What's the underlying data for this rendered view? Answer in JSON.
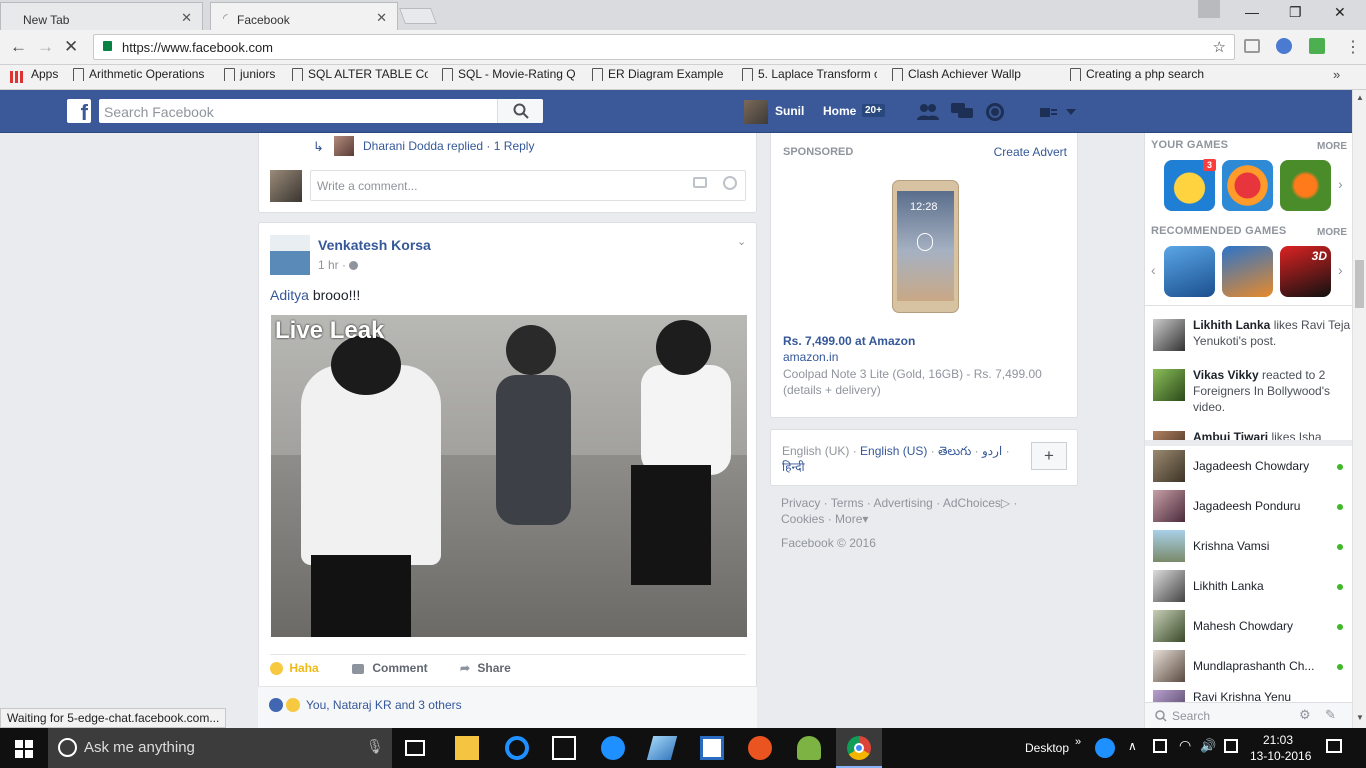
{
  "browser": {
    "tabs": [
      {
        "label": "New Tab"
      },
      {
        "label": "Facebook"
      }
    ],
    "url": "https://www.facebook.com",
    "bookmarks": [
      "Apps",
      "Arithmetic Operations",
      "juniors",
      "SQL ALTER TABLE Con",
      "SQL - Movie-Rating Q",
      "ER Diagram Example",
      "5. Laplace Transform c",
      "Clash Achiever Wallp",
      "Creating a php search"
    ],
    "status": "Waiting for 5-edge-chat.facebook.com..."
  },
  "fb_header": {
    "search_placeholder": "Search Facebook",
    "user": "Sunil",
    "home": "Home",
    "home_badge": "20+"
  },
  "reply_row": {
    "name": "Dharani Dodda replied",
    "sep": "·",
    "count": "1 Reply"
  },
  "comment_placeholder": "Write a comment...",
  "post": {
    "author": "Venkatesh Korsa",
    "time": "1 hr",
    "sep": "·",
    "tag": "Aditya",
    "text": "brooo!!!",
    "watermark": "Live Leak",
    "actions": {
      "haha": "Haha",
      "comment": "Comment",
      "share": "Share"
    },
    "reactions": "You, Nataraj KR and 3 others"
  },
  "ad": {
    "sponsored": "SPONSORED",
    "create": "Create Advert",
    "phone_time": "12:28",
    "title": "Rs. 7,499.00 at Amazon",
    "domain": "amazon.in",
    "desc": "Coolpad Note 3 Lite (Gold, 16GB) - Rs. 7,499.00 (details + delivery)"
  },
  "languages": {
    "current": "English (UK)",
    "sep": "·",
    "en_us": "English (US)",
    "telugu": "తెలుగు",
    "urdu": "اردو",
    "hindi": "हिन्दी",
    "plus": "+"
  },
  "footer": {
    "links": [
      "Privacy",
      "Terms",
      "Advertising",
      "AdChoices",
      "Cookies",
      "More"
    ],
    "copyright": "Facebook © 2016"
  },
  "sidebar": {
    "your_games": "YOUR GAMES",
    "more": "MORE",
    "game_badge": "3",
    "recommended_games": "RECOMMENDED GAMES",
    "game_3d": "3D",
    "ticker": [
      {
        "name": "Likhith Lanka",
        "text": "likes Ravi Teja Yenukoti's post."
      },
      {
        "name": "Vikas Vikky",
        "text": "reacted to 2 Foreigners In Bollywood's video."
      },
      {
        "name": "Ambuj Tiwari",
        "text": "likes Isha"
      }
    ],
    "chat": [
      "Jagadeesh Chowdary",
      "Jagadeesh Ponduru",
      "Krishna Vamsi",
      "Likhith Lanka",
      "Mahesh Chowdary",
      "Mundlaprashanth Ch...",
      "Ravi Krishna Yenu"
    ],
    "chat_search": "Search"
  },
  "taskbar": {
    "cortana": "Ask me anything",
    "desktop": "Desktop",
    "time": "21:03",
    "date": "13-10-2016"
  },
  "colors": {
    "fb_blue": "#3b5998",
    "link": "#365899",
    "online": "#42b72a"
  }
}
